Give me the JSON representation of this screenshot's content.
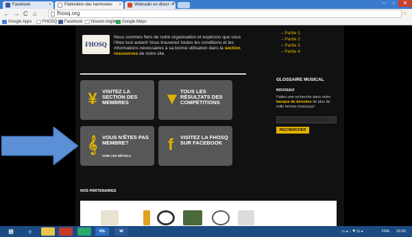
{
  "browser": {
    "tabs": [
      {
        "label": "Facebook",
        "color": "#3b5998"
      },
      {
        "label": "Fédération des harmonies",
        "color": "#ffffff"
      },
      {
        "label": "Webradio en direct - F",
        "color": "#d94a2b"
      }
    ],
    "url": "fhosq.org",
    "bookmarks": [
      {
        "label": "Google Apps",
        "color": "#4a7fd4"
      },
      {
        "label": "FHOSQ",
        "color": "#aaaaaa"
      },
      {
        "label": "Facebook",
        "color": "#3b5998"
      },
      {
        "label": "Nouvel onglet",
        "color": "#aaaaaa"
      },
      {
        "label": "Google Maps",
        "color": "#34a853"
      }
    ]
  },
  "site": {
    "logo_text": "FHOSQ",
    "intro_part1": "Nous sommes fiers de notre organisation et espérons que vous l'êtes tout autant! Vous trouverez toutes les conditions et les informations nécessaires à sa bonne utilisation dans la",
    "intro_link": "section ressources",
    "intro_part2": "de notre site.",
    "parties": [
      "– Partie 1",
      "– Partie 2",
      "– Partie 3",
      "– Partie 4"
    ],
    "tiles": [
      {
        "label": "VISITEZ LA SECTION DES MEMBRES",
        "icon": "member-figure-icon",
        "glyph": "¥"
      },
      {
        "label": "TOUS LES RÉSULTATS DES COMPÉTITIONS",
        "icon": "trophy-icon",
        "glyph": "▼"
      },
      {
        "label": "VOUS N'ÊTES PAS MEMBRE?",
        "sub": "VOIR LES DÉTAILS",
        "icon": "treble-clef-icon",
        "glyph": "𝄞"
      },
      {
        "label": "VISITEZ LA FHOSQ SUR FACEBOOK",
        "icon": "facebook-icon",
        "glyph": "f"
      }
    ],
    "glossary": {
      "title": "GLOSSAIRE MUSICAL",
      "subtitle": "NOUVEAU!",
      "desc_part1": "Faites une recherche dans notre",
      "desc_link": "banque de données",
      "desc_part2": "de plus de mille termes musicaux!",
      "button": "RECHERCHER"
    },
    "partners_title": "NOS PARTENAIRES"
  },
  "taskbar": {
    "lang": "FRA",
    "time": "16:03"
  },
  "colors": {
    "accent": "#e2b100",
    "arrow": "#5b8fd6"
  }
}
